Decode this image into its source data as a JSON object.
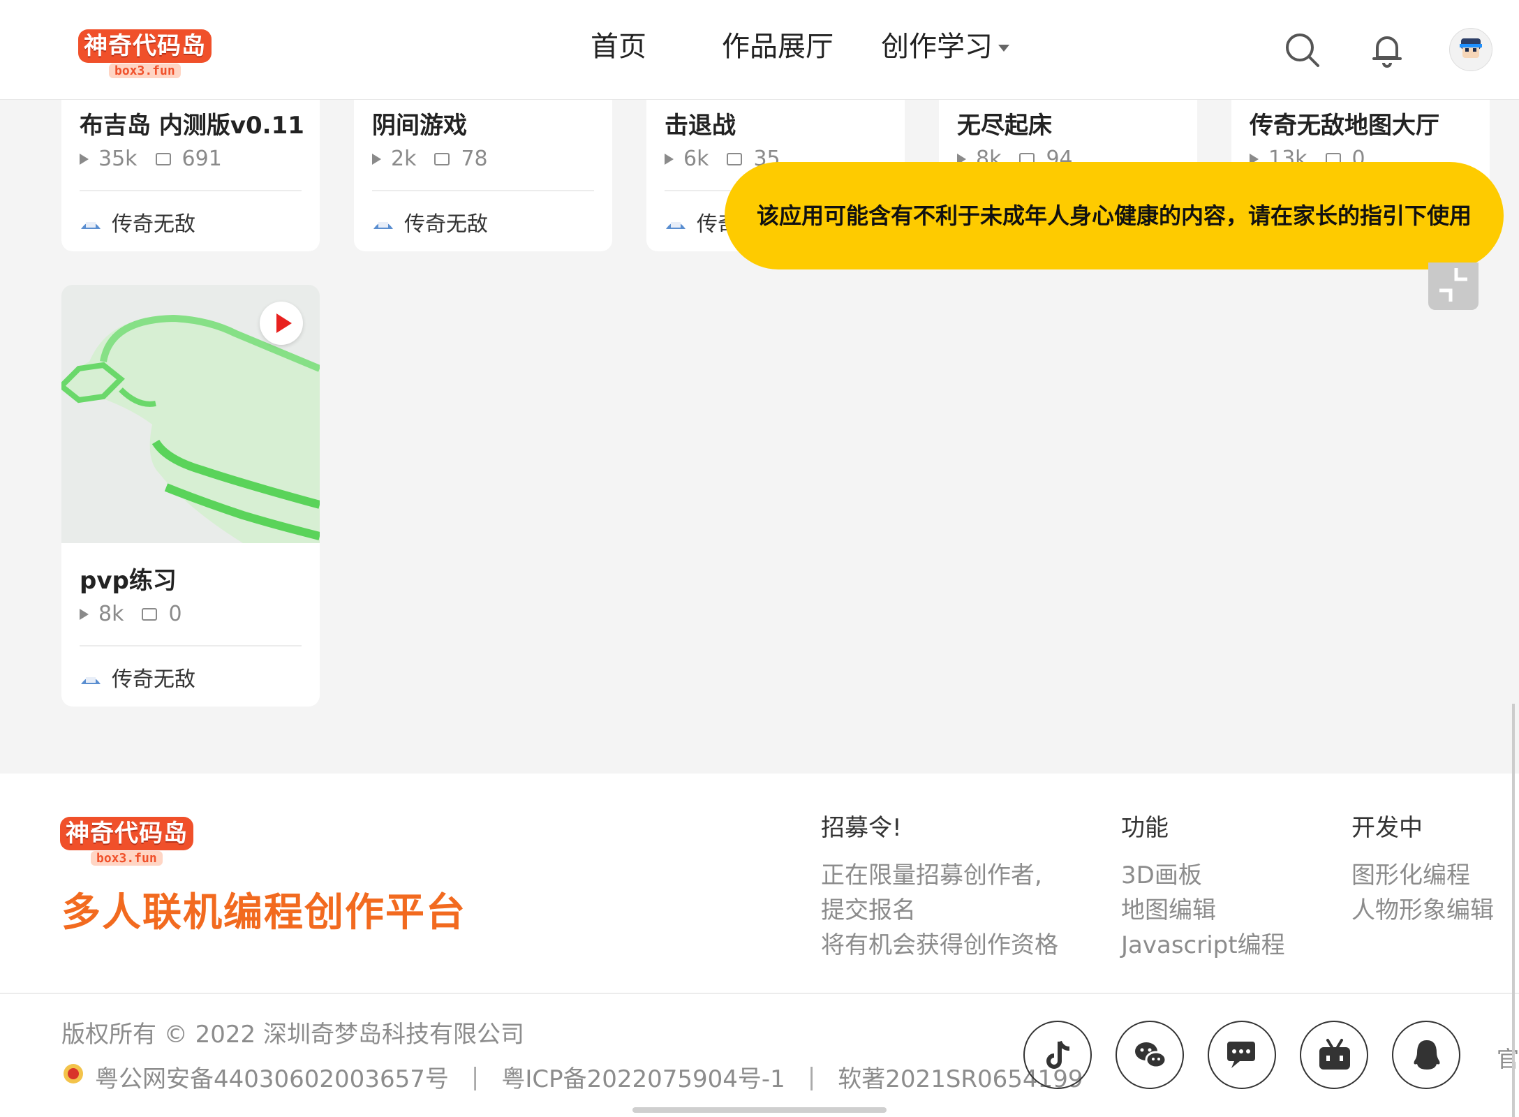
{
  "header": {
    "logo_text": "神奇代码岛",
    "logo_sub": "box3.fun",
    "nav": [
      "首页",
      "作品展厅",
      "创作学习"
    ]
  },
  "cards": [
    {
      "title": "布吉岛 内测版v0.11",
      "plays": "35k",
      "comments": "691",
      "author": "传奇无敌"
    },
    {
      "title": "阴间游戏",
      "plays": "2k",
      "comments": "78",
      "author": "传奇无敌"
    },
    {
      "title": "击退战",
      "plays": "6k",
      "comments": "35",
      "author": "传奇"
    },
    {
      "title": "无尽起床",
      "plays": "8k",
      "comments": "94"
    },
    {
      "title": "传奇无敌地图大厅",
      "plays": "13k",
      "comments": "0"
    },
    {
      "title": "pvp练习",
      "plays": "8k",
      "comments": "0",
      "author": "传奇无敌"
    }
  ],
  "warning": {
    "text": "该应用可能含有不利于未成年人身心健康的内容，请在家长的指引下使用"
  },
  "footer": {
    "logo_text": "神奇代码岛",
    "logo_sub": "box3.fun",
    "slogan": "多人联机编程创作平台",
    "recruit": {
      "title": "招募令!",
      "lines": [
        "正在限量招募创作者,",
        "提交报名",
        "将有机会获得创作资格"
      ]
    },
    "features": {
      "title": "功能",
      "lines": [
        "3D画板",
        "地图编辑",
        "Javascript编程"
      ]
    },
    "developing": {
      "title": "开发中",
      "lines": [
        "图形化编程",
        "人物形象编辑"
      ]
    },
    "copyright": "版权所有 © 2022 深圳奇梦岛科技有限公司",
    "police": "粤公网安备44030602003657号",
    "sep": "|",
    "icp": "粤ICP备2022075904号-1",
    "software": "软著2021SR0654199",
    "partial_text": "官"
  },
  "colors": {
    "accent": "#f26a1f",
    "warning_bg": "#fecb00",
    "play_red": "#e8211f"
  }
}
